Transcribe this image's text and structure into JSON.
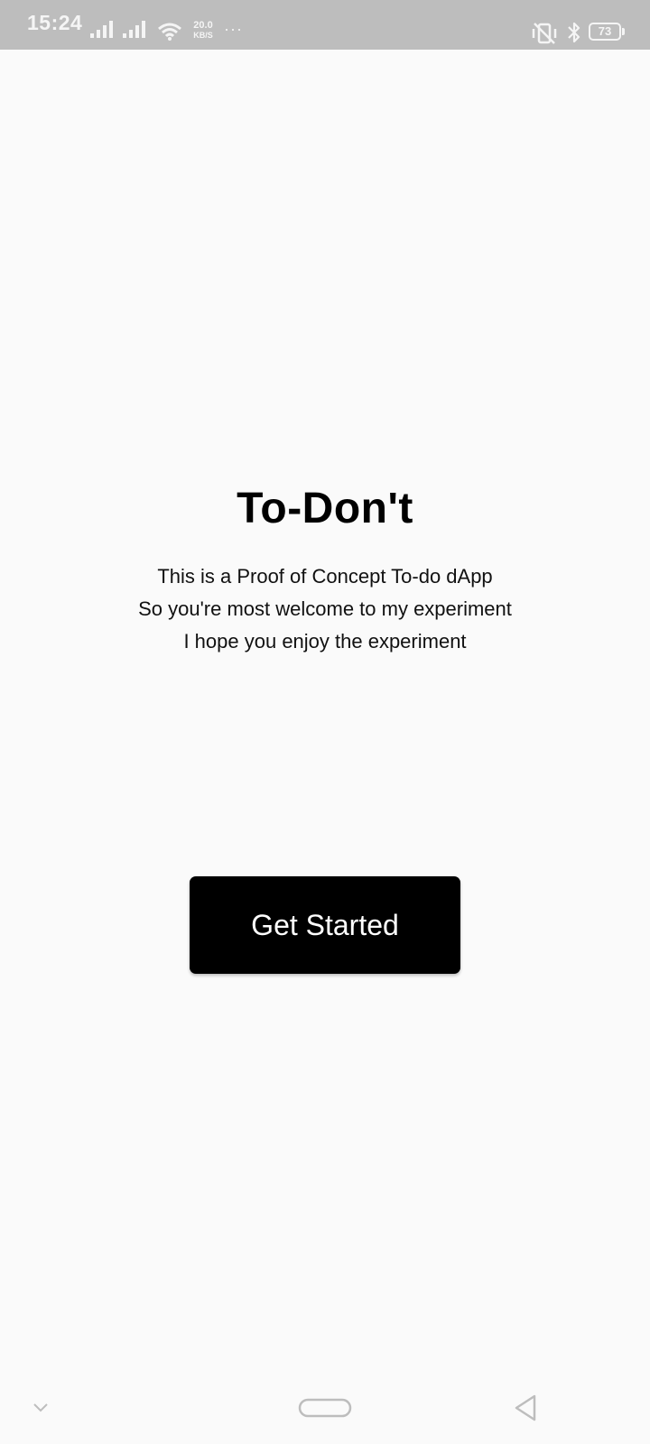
{
  "status_bar": {
    "time": "15:24",
    "net_speed_value": "20.0",
    "net_speed_unit": "KB/S",
    "more_indicator": "···",
    "battery_level": "73",
    "icons": [
      "signal-icon",
      "signal-icon",
      "wifi-icon",
      "vibrate-icon",
      "bluetooth-icon",
      "battery-icon"
    ]
  },
  "main": {
    "title": "To-Don't",
    "intro_lines": [
      "This is a Proof of Concept To-do dApp",
      "So you're most welcome to my experiment",
      "I hope you enjoy the experiment"
    ],
    "get_started_label": "Get Started"
  },
  "nav_bar": {
    "icons": [
      "chevron-down-icon",
      "home-pill-icon",
      "back-triangle-icon"
    ]
  },
  "colors": {
    "background": "#fafafa",
    "status_bar": "#bdbdbd",
    "button": "#000000",
    "button_text": "#ffffff",
    "nav_icons": "#bdbdbd"
  }
}
